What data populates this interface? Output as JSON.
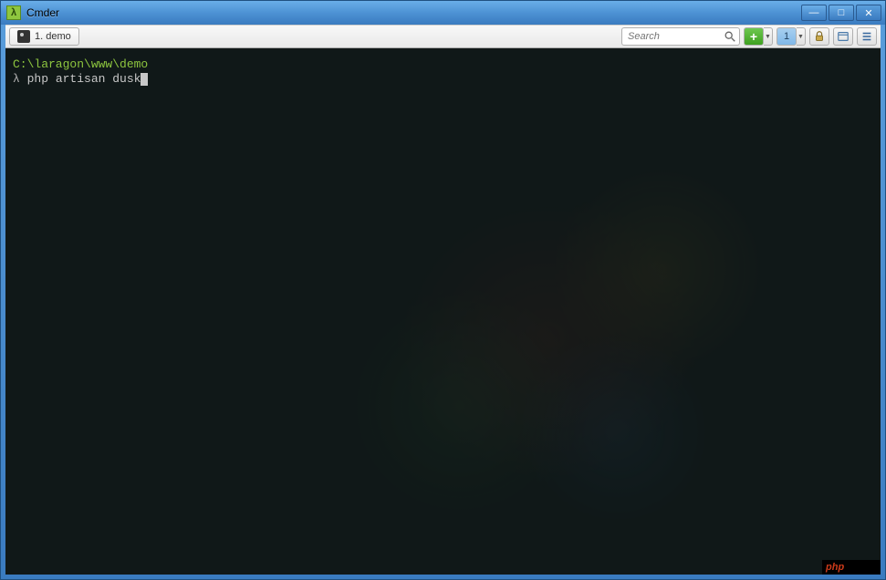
{
  "titlebar": {
    "app_glyph": "λ",
    "title": "Cmder"
  },
  "window_controls": {
    "minimize": "—",
    "maximize": "□",
    "close": "✕"
  },
  "toolbar": {
    "tab_label": "1. demo",
    "search_placeholder": "Search",
    "new_tab_plus": "+",
    "counter_label": "1",
    "dropdown_arrow": "▼"
  },
  "terminal": {
    "path": "C:\\laragon\\www\\demo",
    "prompt_symbol": "λ",
    "command": "php artisan dusk"
  },
  "watermark": {
    "text": "php"
  }
}
